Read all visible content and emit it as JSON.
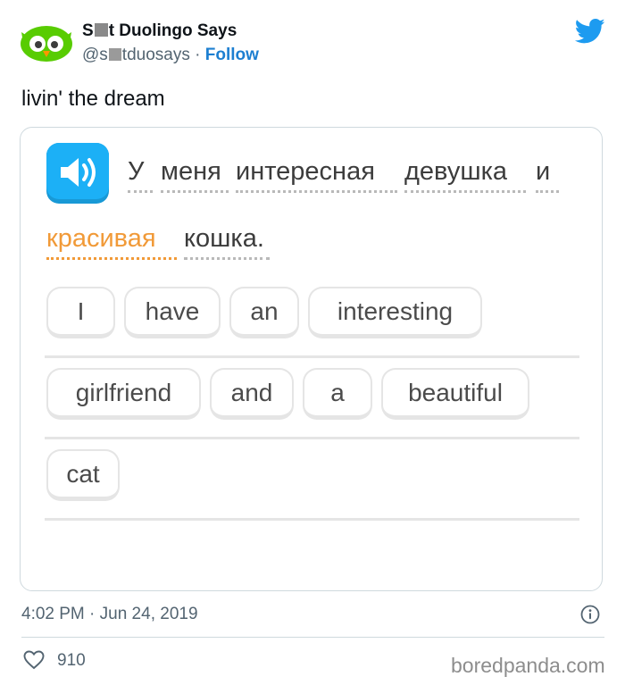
{
  "tweet": {
    "display_name_start": "S",
    "display_name_end": "t Duolingo Says",
    "handle_start": "@s",
    "handle_end": "tduosays",
    "separator": "·",
    "follow_label": "Follow",
    "text": "livin' the dream",
    "timestamp": "4:02 PM · Jun 24, 2019",
    "likes": "910"
  },
  "exercise": {
    "sentence_line1": [
      {
        "text": "У",
        "highlight": false
      },
      {
        "text": "меня",
        "highlight": false
      },
      {
        "text": "интересная",
        "highlight": false
      },
      {
        "text": "девушка",
        "highlight": false
      },
      {
        "text": "и",
        "highlight": false
      }
    ],
    "sentence_line2": [
      {
        "text": "красивая",
        "highlight": true
      },
      {
        "text": "кошка.",
        "highlight": false
      }
    ],
    "tiles": [
      "I",
      "have",
      "an",
      "interesting",
      "girlfriend",
      "and",
      "a",
      "beautiful",
      "cat"
    ]
  },
  "icons": {
    "avatar": "duolingo-owl-icon",
    "brand": "twitter-bird-icon",
    "audio": "speaker-icon",
    "info": "info-icon",
    "like": "heart-icon"
  },
  "colors": {
    "twitter_blue": "#1d9bf0",
    "follow_blue": "#1d7fd1",
    "owl_green": "#58cc02",
    "speaker_blue": "#1cb0f6",
    "highlight_orange": "#f19a38",
    "tile_border": "#e5e5e5"
  },
  "watermark": "boredpanda.com"
}
